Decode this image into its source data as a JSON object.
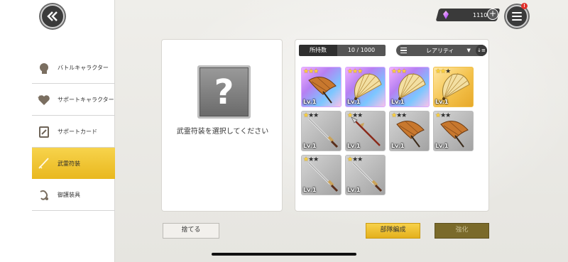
{
  "header": {
    "back_icon": "double-chevron-left-icon",
    "currency_icon": "crystal-gem-icon",
    "currency_value": "1110",
    "plus_label": "+",
    "menu_icon": "hamburger-menu-icon",
    "notification_badge": "!"
  },
  "sidebar": {
    "items": [
      {
        "label": "バトルキャラクター",
        "icon": "character-head-icon",
        "active": false
      },
      {
        "label": "サポートキャラクター",
        "icon": "heart-sparkle-icon",
        "active": false
      },
      {
        "label": "サポートカード",
        "icon": "card-icon",
        "active": false
      },
      {
        "label": "武霊符装",
        "icon": "blade-icon",
        "active": true
      },
      {
        "label": "御護装具",
        "icon": "guard-ornament-icon",
        "active": false
      }
    ]
  },
  "detail": {
    "placeholder_symbol": "?",
    "message": "武霊符装を選択してください"
  },
  "inventory": {
    "owned_label": "所持数",
    "owned_count": "10 / 1000",
    "sort_label": "レアリティ",
    "sort_caret": "▼",
    "sort_direction_icon": "sort-descending-icon",
    "items": [
      {
        "item": "umbrella",
        "rarity": 3,
        "level": "Lv.1"
      },
      {
        "item": "fan",
        "rarity": 3,
        "level": "Lv.1"
      },
      {
        "item": "fan",
        "rarity": 3,
        "level": "Lv.1"
      },
      {
        "item": "fan",
        "rarity": 2,
        "level": "Lv.1"
      },
      {
        "item": "katana",
        "rarity": 1,
        "level": "Lv.1"
      },
      {
        "item": "spear",
        "rarity": 1,
        "level": "Lv.1"
      },
      {
        "item": "umbrella",
        "rarity": 1,
        "level": "Lv.1"
      },
      {
        "item": "umbrella",
        "rarity": 1,
        "level": "Lv.1"
      },
      {
        "item": "katana",
        "rarity": 1,
        "level": "Lv.1"
      },
      {
        "item": "katana",
        "rarity": 1,
        "level": "Lv.1"
      }
    ]
  },
  "footer": {
    "discard_label": "捨てる",
    "formation_label": "部隊編成",
    "enhance_label": "強化"
  },
  "colors": {
    "active_tab": "#efc431",
    "rarity3_bg": "#c08cf5",
    "rarity4_bg": "#f4c24c",
    "rarity1_bg": "#b5b5b5"
  }
}
